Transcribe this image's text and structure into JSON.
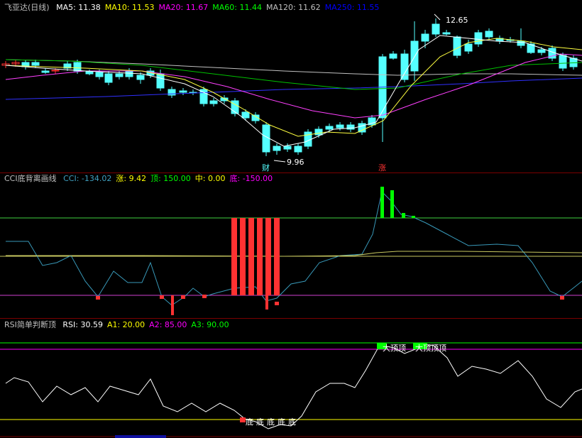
{
  "main": {
    "title": "飞亚达(日线)",
    "ma": [
      {
        "label": "MA5: 11.38",
        "color": "#ffffff"
      },
      {
        "label": "MA10: 11.53",
        "color": "#ffff00"
      },
      {
        "label": "MA20: 11.67",
        "color": "#ff00ff"
      },
      {
        "label": "MA60: 11.44",
        "color": "#00ff00"
      },
      {
        "label": "MA120: 11.62",
        "color": "#c0c0c0"
      },
      {
        "label": "MA250: 11.55",
        "color": "#0000ff"
      }
    ],
    "high_label": "12.65",
    "low_label": "9.96",
    "marker_cai": "财",
    "marker_zhang": "涨"
  },
  "cci": {
    "title": "CCI底背离画线",
    "values": [
      {
        "label": "CCI: -134.02",
        "color": "#40a0c0"
      },
      {
        "label": "涨: 9.42",
        "color": "#ffff00"
      },
      {
        "label": "顶: 150.00",
        "color": "#00ff00"
      },
      {
        "label": "中: 0.00",
        "color": "#ffff00"
      },
      {
        "label": "底: -150.00",
        "color": "#ff00ff"
      }
    ]
  },
  "rsi": {
    "title": "RSI简单判断顶",
    "values": [
      {
        "label": "RSI: 30.59",
        "color": "#ffffff"
      },
      {
        "label": "A1: 20.00",
        "color": "#ffff00"
      },
      {
        "label": "A2: 85.00",
        "color": "#ff00ff"
      },
      {
        "label": "A3: 90.00",
        "color": "#00ff00"
      }
    ],
    "top_labels": [
      "大顶顶",
      "大顶顶顶"
    ],
    "bottom_labels": [
      "底",
      "底",
      "底",
      "底",
      "底"
    ]
  },
  "colors": {
    "up": "#ff3232",
    "down": "#54ffff",
    "background": "#000000",
    "divider": "#7a0000"
  }
}
